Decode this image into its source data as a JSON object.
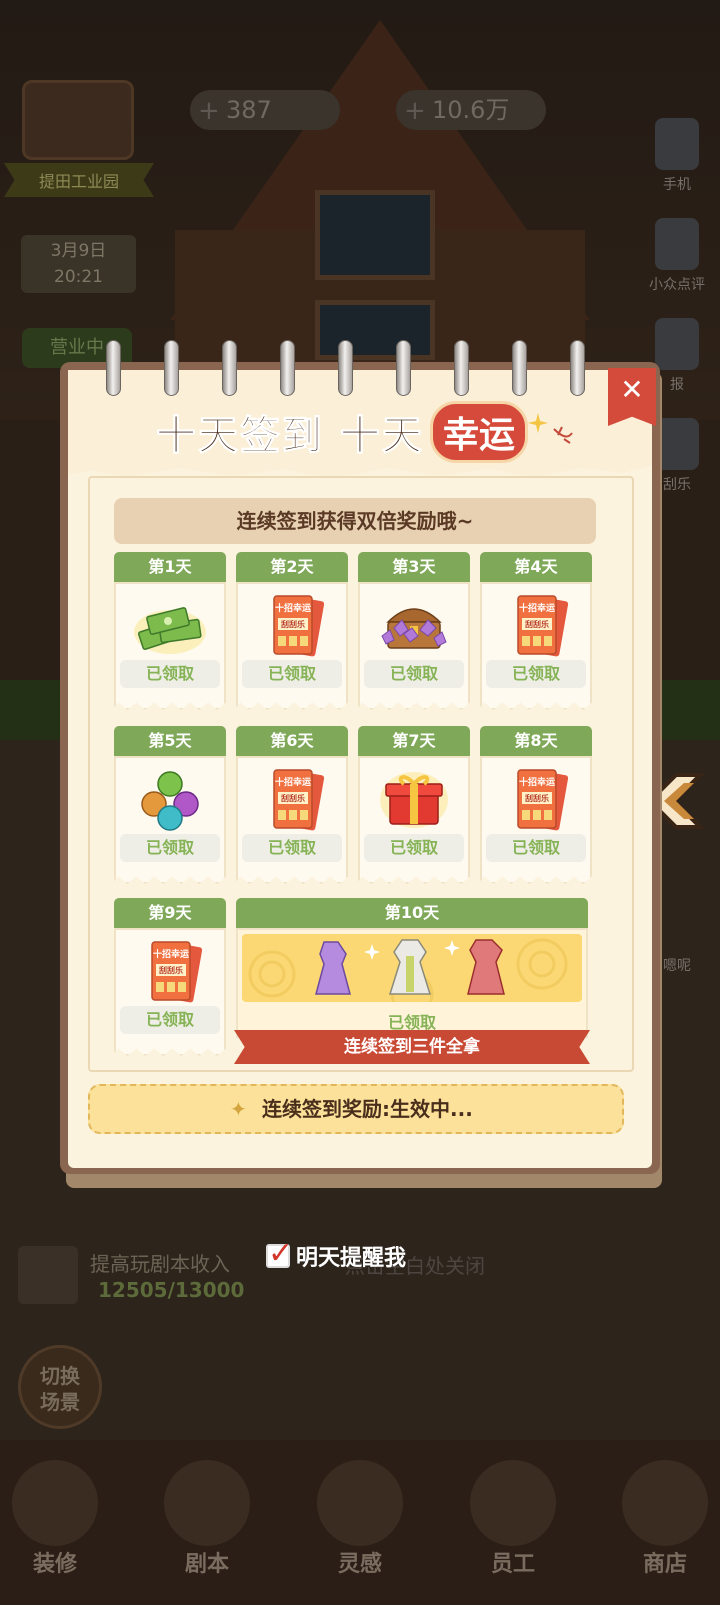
{
  "hud": {
    "location": "提田工业园",
    "date": "3月9日",
    "time": "20:21",
    "business_status": "营业中",
    "gems": "387",
    "money": "10.6万"
  },
  "side_menu": [
    "手机",
    "小众点评",
    "报",
    "刮乐",
    "嗯呢"
  ],
  "dialog": {
    "title_main": "十天签到 十天",
    "title_badge": "幸运",
    "close_symbol": "✕",
    "banner": "连续签到获得双倍奖励哦~",
    "days": [
      {
        "label": "第1天",
        "reward": "money-stack-icon",
        "status": "已领取"
      },
      {
        "label": "第2天",
        "reward": "scratch-ticket-icon",
        "status": "已领取"
      },
      {
        "label": "第3天",
        "reward": "treasure-chest-icon",
        "status": "已领取"
      },
      {
        "label": "第4天",
        "reward": "scratch-ticket-icon",
        "status": "已领取"
      },
      {
        "label": "第5天",
        "reward": "orbs-icon",
        "status": "已领取"
      },
      {
        "label": "第6天",
        "reward": "scratch-ticket-icon",
        "status": "已领取"
      },
      {
        "label": "第7天",
        "reward": "gift-box-icon",
        "status": "已领取"
      },
      {
        "label": "第8天",
        "reward": "scratch-ticket-icon",
        "status": "已领取"
      },
      {
        "label": "第9天",
        "reward": "scratch-ticket-icon",
        "status": "已领取"
      }
    ],
    "day10": {
      "label": "第10天",
      "status": "已领取",
      "ribbon": "连续签到三件全拿"
    },
    "ticket_text_top": "十招幸运",
    "ticket_text_mid": "刮刮乐",
    "streak_status": "连续签到奖励:生效中..."
  },
  "remind_label": "明天提醒我",
  "close_hint": "点击空白处关闭",
  "promo": {
    "title": "提高玩剧本收入",
    "progress": "12505/13000"
  },
  "switch_scene": [
    "切换",
    "场景"
  ],
  "bottom_nav": [
    "装修",
    "剧本",
    "灵感",
    "员工",
    "商店"
  ],
  "colors": {
    "accent_green": "#7fa858",
    "accent_red": "#d54a3a",
    "paper": "#fbf3dd"
  }
}
